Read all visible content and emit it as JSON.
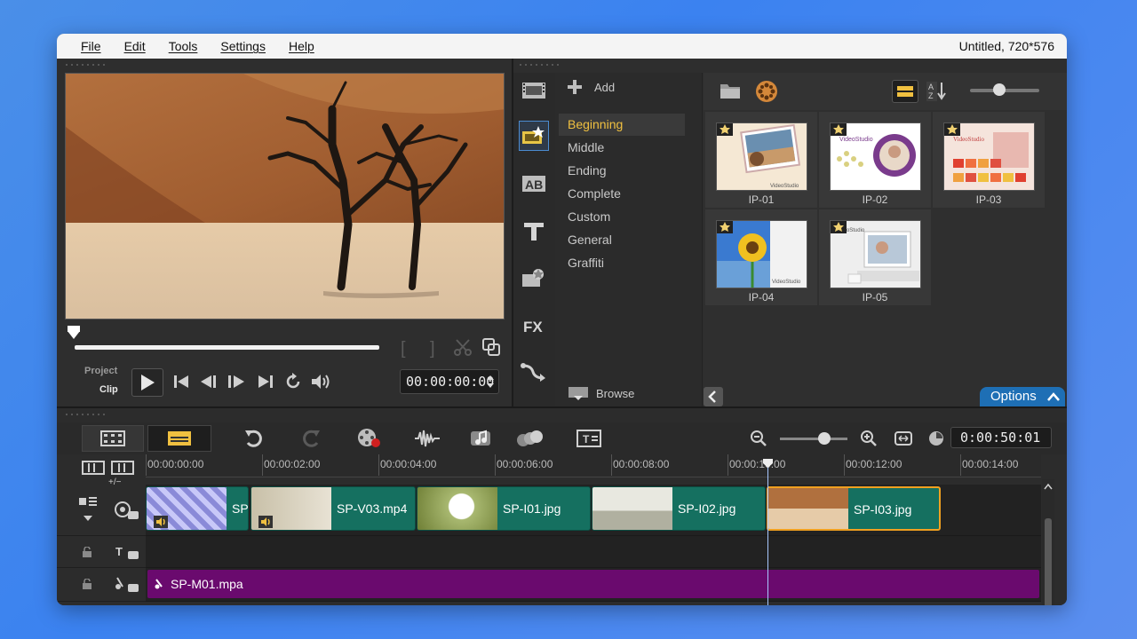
{
  "menu": {
    "items": [
      "File",
      "Edit",
      "Tools",
      "Settings",
      "Help"
    ],
    "project_title": "Untitled, 720*576"
  },
  "preview": {
    "mode_project": "Project",
    "mode_clip": "Clip",
    "timecode": "00:00:00:00"
  },
  "library": {
    "add_label": "Add",
    "categories": [
      "Beginning",
      "Middle",
      "Ending",
      "Complete",
      "Custom",
      "General",
      "Graffiti"
    ],
    "active_category": "Beginning",
    "browse_label": "Browse",
    "options_label": "Options",
    "thumbnails": [
      {
        "label": "IP-01"
      },
      {
        "label": "IP-02"
      },
      {
        "label": "IP-03"
      },
      {
        "label": "IP-04"
      },
      {
        "label": "IP-05"
      }
    ],
    "thumb_texts": {
      "ip01": "VideoStudio",
      "ip02": "VideoStudio",
      "ip03": "VideoStudio",
      "ip04": "VideoStudio",
      "ip05": "VideoStudio"
    }
  },
  "timeline": {
    "timecode": "0:00:50:01",
    "ruler_labels": [
      "00:00:00:00",
      "00:00:02:00",
      "00:00:04:00",
      "00:00:06:00",
      "00:00:08:00",
      "00:00:10:00",
      "00:00:12:00",
      "00:00:14:00"
    ],
    "add_remove_label": "+/−",
    "video_clips": [
      {
        "name": "SP"
      },
      {
        "name": "SP-V03.mp4"
      },
      {
        "name": "SP-I01.jpg"
      },
      {
        "name": "SP-I02.jpg"
      },
      {
        "name": "SP-I03.jpg"
      }
    ],
    "audio_clip": "SP-M01.mpa"
  },
  "colors": {
    "accent": "#1e6fb5",
    "active_category": "#f0c040",
    "video_clip": "#157060",
    "audio_clip": "#6a0a6e",
    "selection": "#f0a020"
  }
}
